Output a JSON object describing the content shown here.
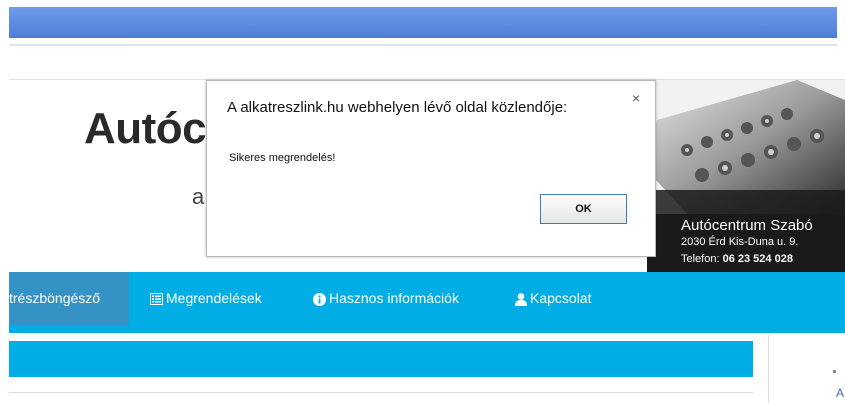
{
  "header": {
    "title": "Autóc",
    "subtitle": "a"
  },
  "banner": {
    "title": "Autócentrum Szabó",
    "address": "2030 Érd Kis-Duna u. 9.",
    "phone_label": "Telefon: ",
    "phone_number": "06 23 524 028"
  },
  "nav": {
    "items": [
      {
        "label": "trészböngésző",
        "icon": "none"
      },
      {
        "label": "Megrendelések",
        "icon": "list-icon"
      },
      {
        "label": "Hasznos információk",
        "icon": "info-icon"
      },
      {
        "label": "Kapcsolat",
        "icon": "user-icon"
      }
    ],
    "active_index": 0
  },
  "sidebar": {
    "partial_text": "A"
  },
  "dialog": {
    "title": "A alkatreszlink.hu webhelyen lévő oldal közlendője:",
    "close_label": "×",
    "message": "Sikeres megrendelés!",
    "ok_label": "OK"
  },
  "colors": {
    "nav_background": "#00aee5",
    "nav_active": "#3592c4",
    "browser_bar": "#5a88de",
    "ok_border": "#3c7fb1"
  }
}
